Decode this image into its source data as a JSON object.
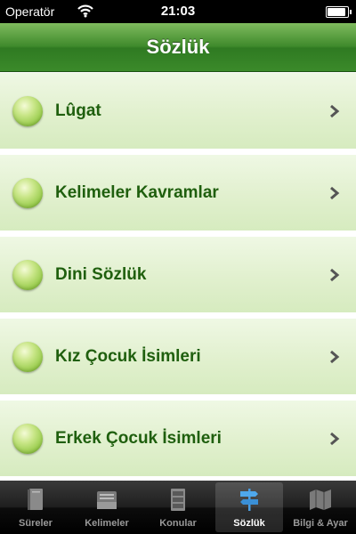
{
  "status_bar": {
    "carrier": "Operatör",
    "time": "21:03",
    "battery_level": 1.0
  },
  "nav": {
    "title": "Sözlük"
  },
  "list": {
    "items": [
      {
        "label": "Lûgat"
      },
      {
        "label": "Kelimeler Kavramlar"
      },
      {
        "label": "Dini Sözlük"
      },
      {
        "label": "Kız Çocuk İsimleri"
      },
      {
        "label": "Erkek Çocuk İsimleri"
      }
    ]
  },
  "tabs": {
    "items": [
      {
        "label": "Süreler",
        "icon": "book-icon"
      },
      {
        "label": "Kelimeler",
        "icon": "inbox-tray-icon"
      },
      {
        "label": "Konular",
        "icon": "file-cabinet-icon"
      },
      {
        "label": "Sözlük",
        "icon": "signpost-icon",
        "selected": true
      },
      {
        "label": "Bilgi & Ayar",
        "icon": "map-icon"
      }
    ]
  },
  "colors": {
    "nav_green": "#3f8a2c",
    "label_green": "#1f5f0e",
    "row_bg": "#e1f0ce",
    "tab_bar": "#1e1e1e"
  }
}
